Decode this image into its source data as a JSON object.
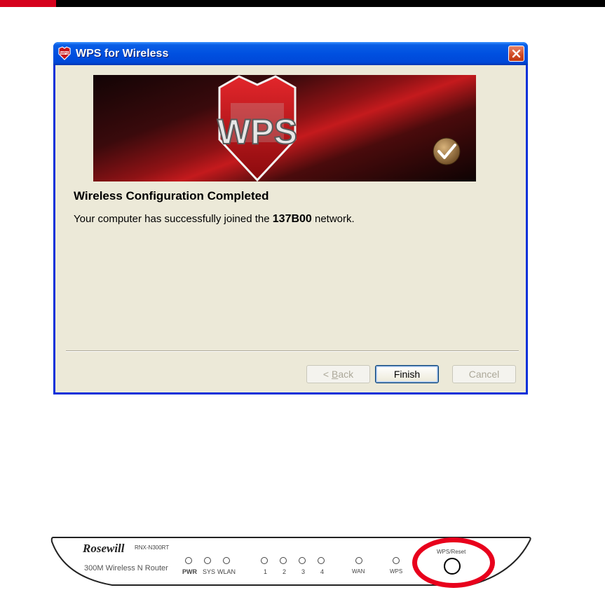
{
  "dialog": {
    "title": "WPS for Wireless",
    "banner_text": "WPS",
    "heading": "Wireless Configuration Completed",
    "message_before": "Your computer has successfully joined the ",
    "network_name": "137B00",
    "message_after": " network.",
    "buttons": {
      "back_prefix": "< ",
      "back_mnemonic": "B",
      "back_rest": "ack",
      "finish": "Finish",
      "cancel": "Cancel"
    }
  },
  "router": {
    "brand": "Rosewill",
    "model": "RNX-N300RT",
    "name": "300M Wireless N Router",
    "leds": [
      "PWR",
      "SYS",
      "WLAN",
      "1",
      "2",
      "3",
      "4",
      "WAN",
      "WPS"
    ],
    "reset_label": "WPS/Reset"
  },
  "colors": {
    "highlight": "#e8001c",
    "title_blue": "#0050e0",
    "dialog_face": "#ece9d8"
  }
}
